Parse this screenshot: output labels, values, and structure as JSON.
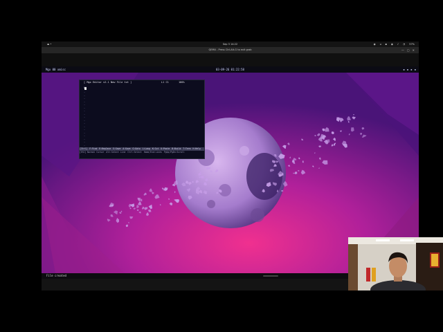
{
  "host_topbar": {
    "activities": "",
    "clock": "Sep 3  14:22",
    "tray": [
      "◉",
      "◂",
      "▪",
      "◉",
      "♪",
      "◔",
      "57%"
    ]
  },
  "qemu_window": {
    "title": "QEMU - Press Ctrl-Alt-G to exit grab",
    "controls": [
      "—",
      "▢",
      "✕"
    ]
  },
  "vm_bar": {
    "workspaces": "Mgx 00  xmisc",
    "clock": "03-09-26   01:22:58",
    "tray_icons": [
      "▪",
      "▪",
      "▪",
      "▪"
    ]
  },
  "editor": {
    "title": "[ Mgx Editor v2.1  New File txt ]",
    "position": "L1 C1",
    "percent": "100%",
    "line_number": "01",
    "tildes": [
      "~",
      "~",
      "~",
      "~",
      "~",
      "~",
      "~",
      "~",
      "~",
      "~",
      "~",
      "~",
      "~",
      "~",
      "~",
      "~",
      "~",
      "~"
    ],
    "menu": [
      "[Ctrl]",
      "F:Find",
      "R:Replace",
      "S:Save",
      "A:Save",
      "G:Goto",
      "L:Lang",
      "K:Cut",
      "U:Paste",
      "B:Build",
      "T:Term",
      "H:Help"
    ],
    "hints": [
      "[ESC] Normal Cursor",
      "Alt:Select Line",
      "Ctrl:Select",
      "Home/End:Lines",
      "PgUp/PgDn:Scroll"
    ]
  },
  "vm_status": {
    "message": "File created"
  },
  "colors": {
    "accent": "#e01e8c",
    "wallpaper_base": "#6a1a82",
    "planet": "#b58ad8"
  }
}
